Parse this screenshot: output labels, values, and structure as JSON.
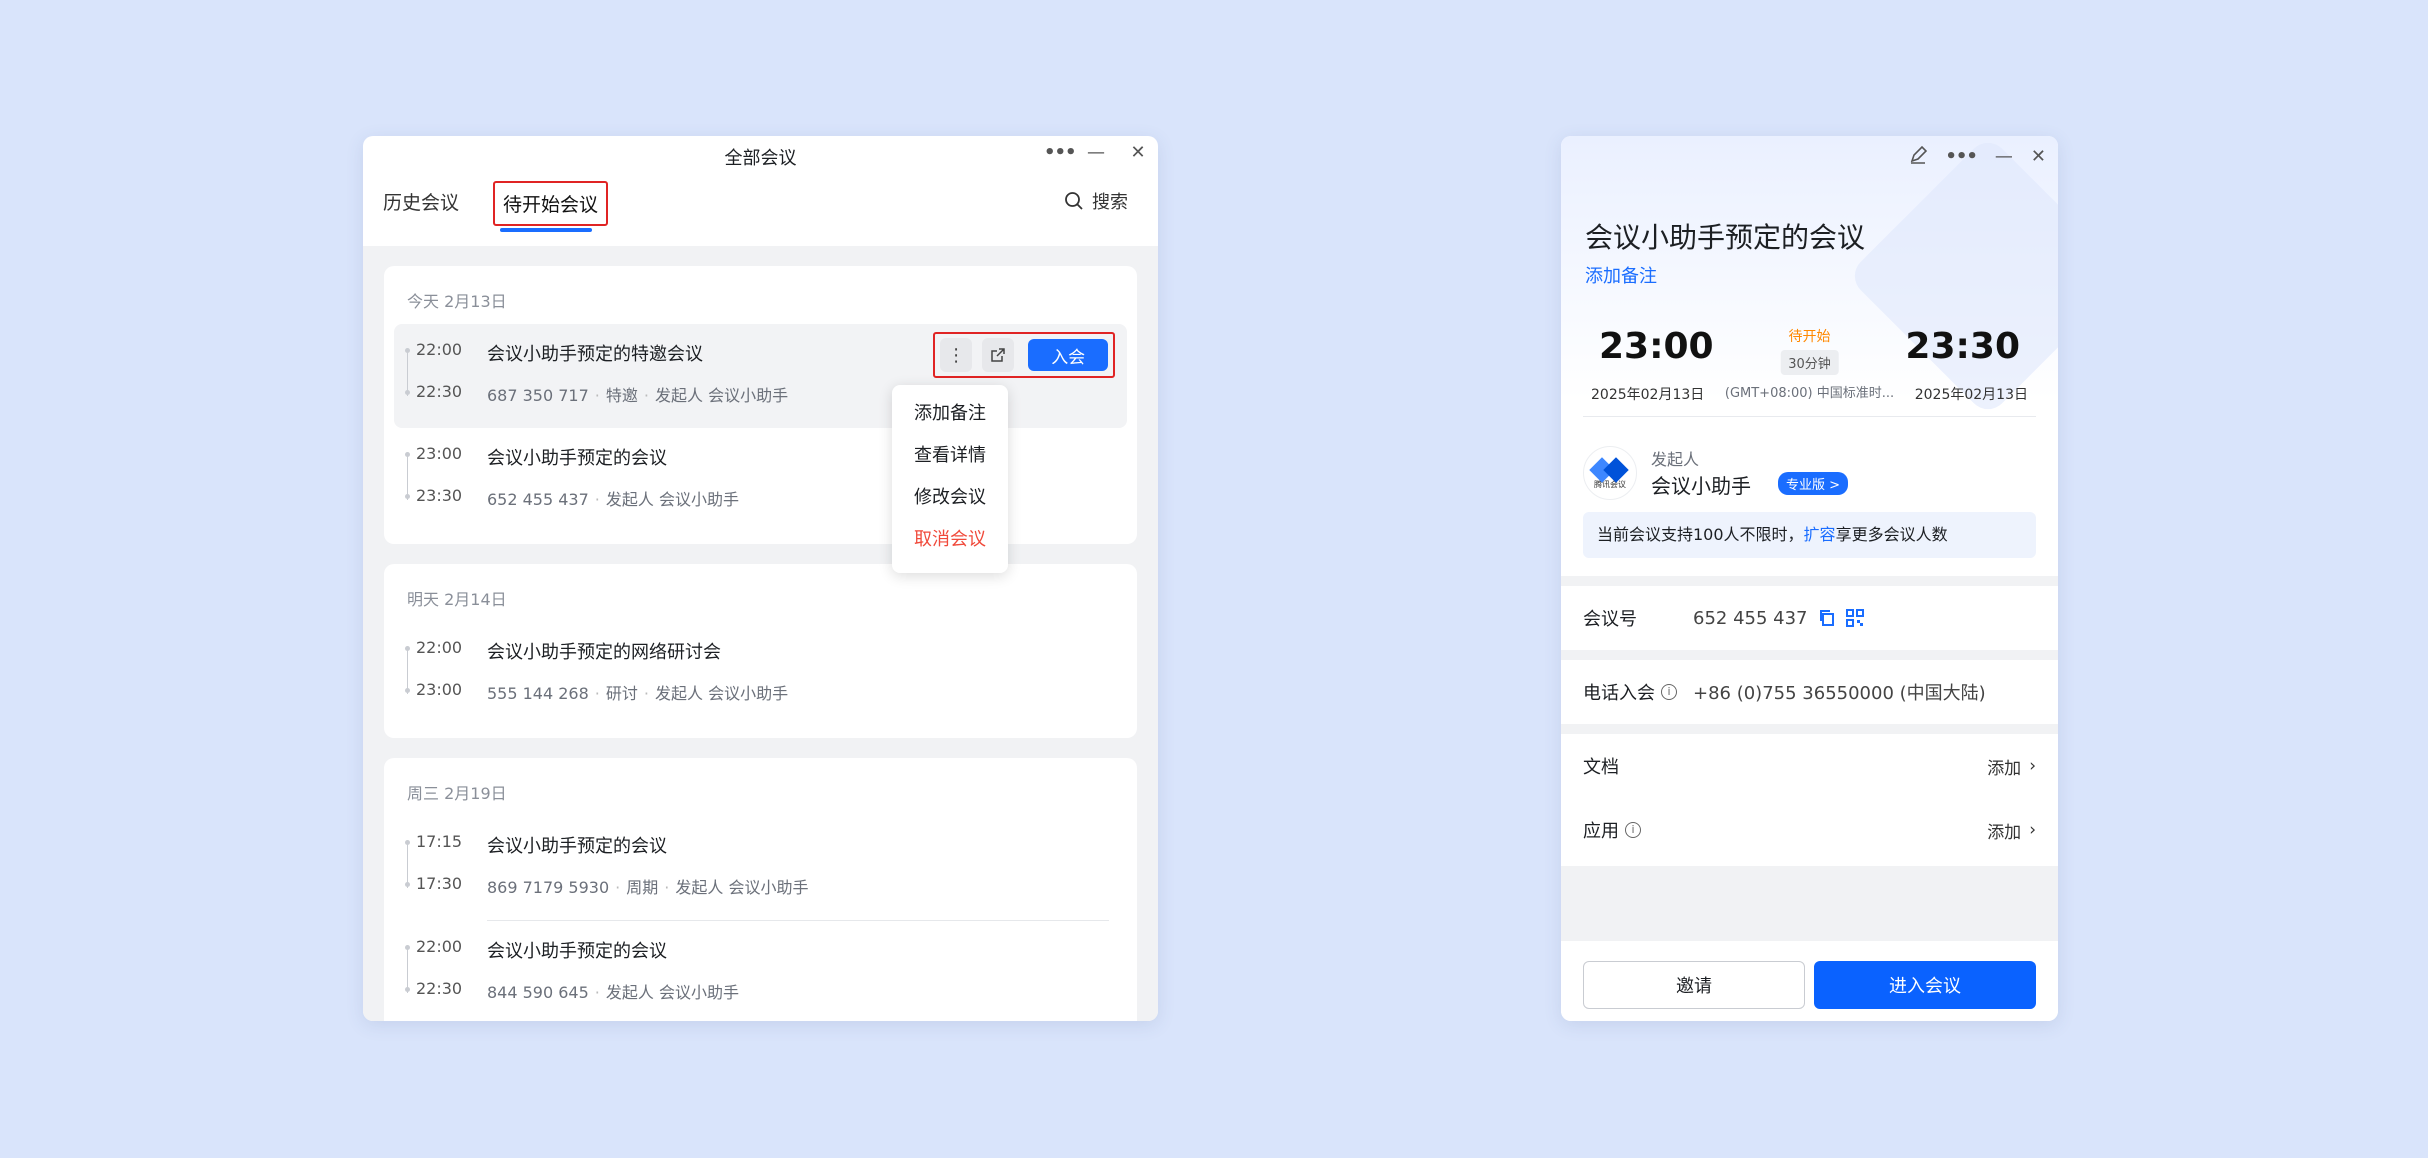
{
  "list_window": {
    "title": "全部会议",
    "tabs": {
      "history": "历史会议",
      "upcoming": "待开始会议"
    },
    "search_label": "搜索",
    "days": [
      {
        "header": "今天 2月13日",
        "meetings": [
          {
            "start": "22:00",
            "end": "22:30",
            "name": "会议小助手预定的特邀会议",
            "number": "687 350 717",
            "tag": "特邀",
            "host": "发起人 会议小助手"
          },
          {
            "start": "23:00",
            "end": "23:30",
            "name": "会议小助手预定的会议",
            "number": "652 455 437",
            "host": "发起人 会议小助手"
          }
        ]
      },
      {
        "header": "明天 2月14日",
        "meetings": [
          {
            "start": "22:00",
            "end": "23:00",
            "name": "会议小助手预定的网络研讨会",
            "number": "555 144 268",
            "tag": "研讨",
            "host": "发起人 会议小助手"
          }
        ]
      },
      {
        "header": "周三 2月19日",
        "meetings": [
          {
            "start": "17:15",
            "end": "17:30",
            "name": "会议小助手预定的会议",
            "number": "869 7179 5930",
            "tag": "周期",
            "host": "发起人 会议小助手"
          },
          {
            "start": "22:00",
            "end": "22:30",
            "name": "会议小助手预定的会议",
            "number": "844 590 645",
            "host": "发起人 会议小助手"
          }
        ]
      }
    ],
    "join_label": "入会",
    "context_menu": [
      "添加备注",
      "查看详情",
      "修改会议",
      "取消会议"
    ]
  },
  "detail_window": {
    "title": "会议小助手预定的会议",
    "add_note": "添加备注",
    "start_time": "23:00",
    "end_time": "23:30",
    "start_date": "2025年02月13日",
    "end_date": "2025年02月13日",
    "status": "待开始",
    "duration": "30分钟",
    "timezone": "(GMT+08:00) 中国标准时...",
    "host_label": "发起人",
    "host_name": "会议小助手",
    "logo_text": "腾讯会议",
    "pro_badge": "专业版 >",
    "capacity_prefix": "当前会议支持100人不限时，",
    "capacity_link": "扩容",
    "capacity_suffix": "享更多会议人数",
    "meeting_id_label": "会议号",
    "meeting_id": "652 455 437",
    "phone_label": "电话入会",
    "phone": "+86 (0)755 36550000 (中国大陆)",
    "docs_label": "文档",
    "apps_label": "应用",
    "add_label": "添加",
    "invite_label": "邀请",
    "enter_label": "进入会议"
  },
  "colors": {
    "accent": "#1a6dff",
    "danger": "#f04a3b",
    "status": "#ff8800",
    "highlight_box": "#e02424"
  }
}
